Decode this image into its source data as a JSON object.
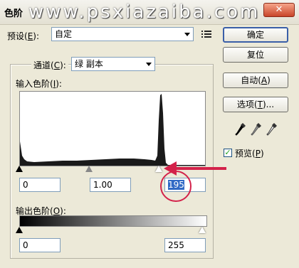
{
  "dialog": {
    "title": "色阶",
    "watermark": "www.psxiazaiba.com",
    "close_glyph": "✕"
  },
  "preset": {
    "label": "预设(E):",
    "label_plain": "预设(",
    "key": "E",
    "label_end": "):",
    "value": "自定",
    "menu_icon": "preset-options-icon"
  },
  "channel": {
    "label_plain": "通道(",
    "key": "C",
    "label_end": "):",
    "value": "绿 副本"
  },
  "input_levels": {
    "label_plain": "输入色阶(",
    "key": "I",
    "label_end": "):",
    "shadow": "0",
    "midtone": "1.00",
    "highlight": "195"
  },
  "output_levels": {
    "label_plain": "输出色阶(",
    "key": "O",
    "label_end": "):",
    "shadow": "0",
    "highlight": "255"
  },
  "buttons": {
    "ok": "确定",
    "reset": "复位",
    "auto_plain": "自动(",
    "auto_key": "A",
    "auto_end": ")",
    "options_plain": "选项(",
    "options_key": "T",
    "options_end": ")..."
  },
  "preview": {
    "label_plain": "预览(",
    "key": "P",
    "label_end": ")",
    "checked": true
  },
  "icons": [
    "black-eyedropper-icon",
    "gray-eyedropper-icon",
    "white-eyedropper-icon",
    "preset-options-icon",
    "close-icon"
  ],
  "annotation_color": "#d3224a"
}
